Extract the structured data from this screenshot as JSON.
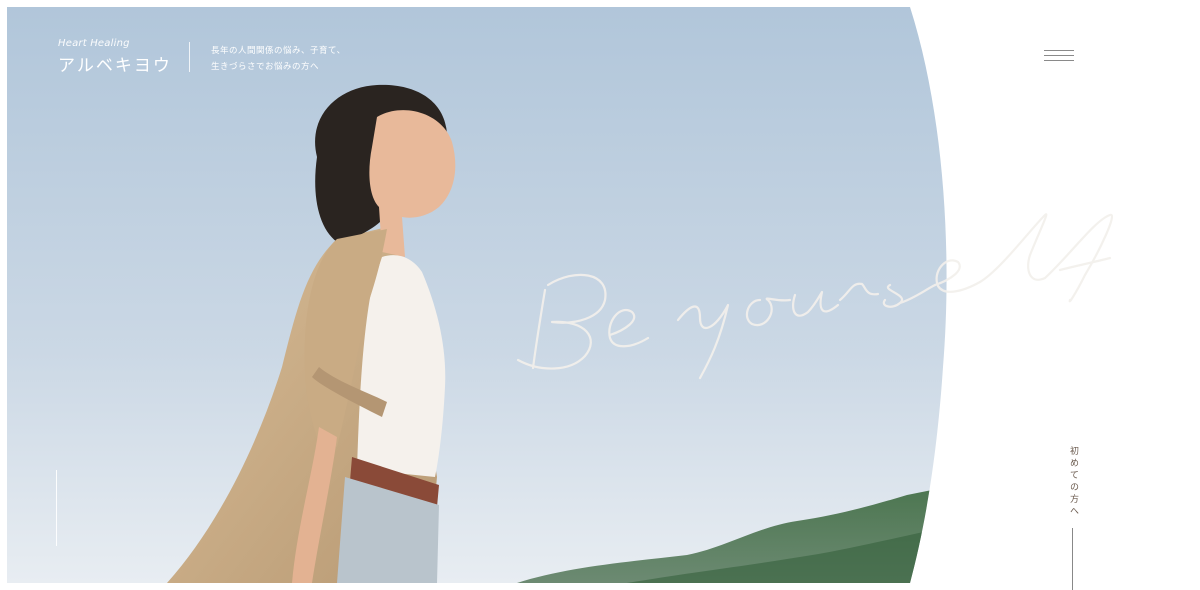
{
  "brand": {
    "sub": "Heart Healing",
    "name": "アルベキヨウ"
  },
  "tagline": {
    "line1": "長年の人間関係の悩み、子育て、",
    "line2": "生きづらさでお悩みの方へ"
  },
  "hero": {
    "script_text": "Be yourself",
    "sky_top": "#b3c8dc",
    "sky_bottom": "#e9eef3",
    "mountain_color": "#3f6b44"
  },
  "menu": {
    "icon": "hamburger-menu-icon"
  },
  "first_visit_link": "初めての方へ"
}
